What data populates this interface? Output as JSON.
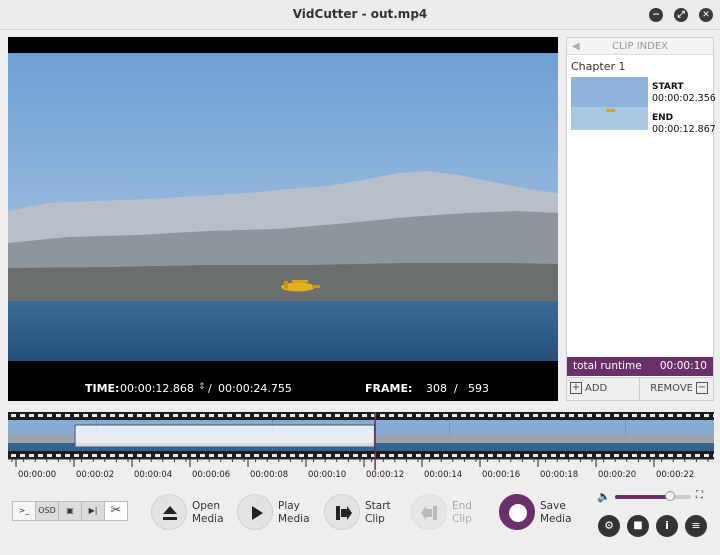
{
  "window": {
    "title": "VidCutter - out.mp4"
  },
  "player": {
    "time_label": "TIME:",
    "time_current": "00:00:12.868",
    "time_sep": "/",
    "time_total": "00:00:24.755",
    "frame_label": "FRAME:",
    "frame_current": "308",
    "frame_sep": "/",
    "frame_total": "593"
  },
  "clip_index": {
    "header": "CLIP INDEX",
    "clips": [
      {
        "chapter": "Chapter 1",
        "start_label": "START",
        "start": "00:00:02.356",
        "end_label": "END",
        "end": "00:00:12.867"
      }
    ],
    "runtime_label": "total runtime",
    "runtime_value": "00:00:10",
    "add_label": "ADD",
    "remove_label": "REMOVE"
  },
  "timeline": {
    "ticks": [
      "00:00:00",
      "00:00:02",
      "00:00:04",
      "00:00:06",
      "00:00:08",
      "00:00:10",
      "00:00:12",
      "00:00:14",
      "00:00:16",
      "00:00:18",
      "00:00:20",
      "00:00:22"
    ],
    "playhead_fraction": 0.52,
    "clip_range": [
      0.095,
      0.519
    ]
  },
  "toolbar": {
    "console_label": ">_",
    "osd_label": "OSD",
    "open_label": "Open\nMedia",
    "play_label": "Play\nMedia",
    "start_clip_label": "Start\nClip",
    "end_clip_label": "End\nClip",
    "save_label": "Save\nMedia",
    "volume_fraction": 0.72
  },
  "colors": {
    "accent": "#6b2f69",
    "sky": "#7fa9d6",
    "sea": "#2f5f88"
  }
}
